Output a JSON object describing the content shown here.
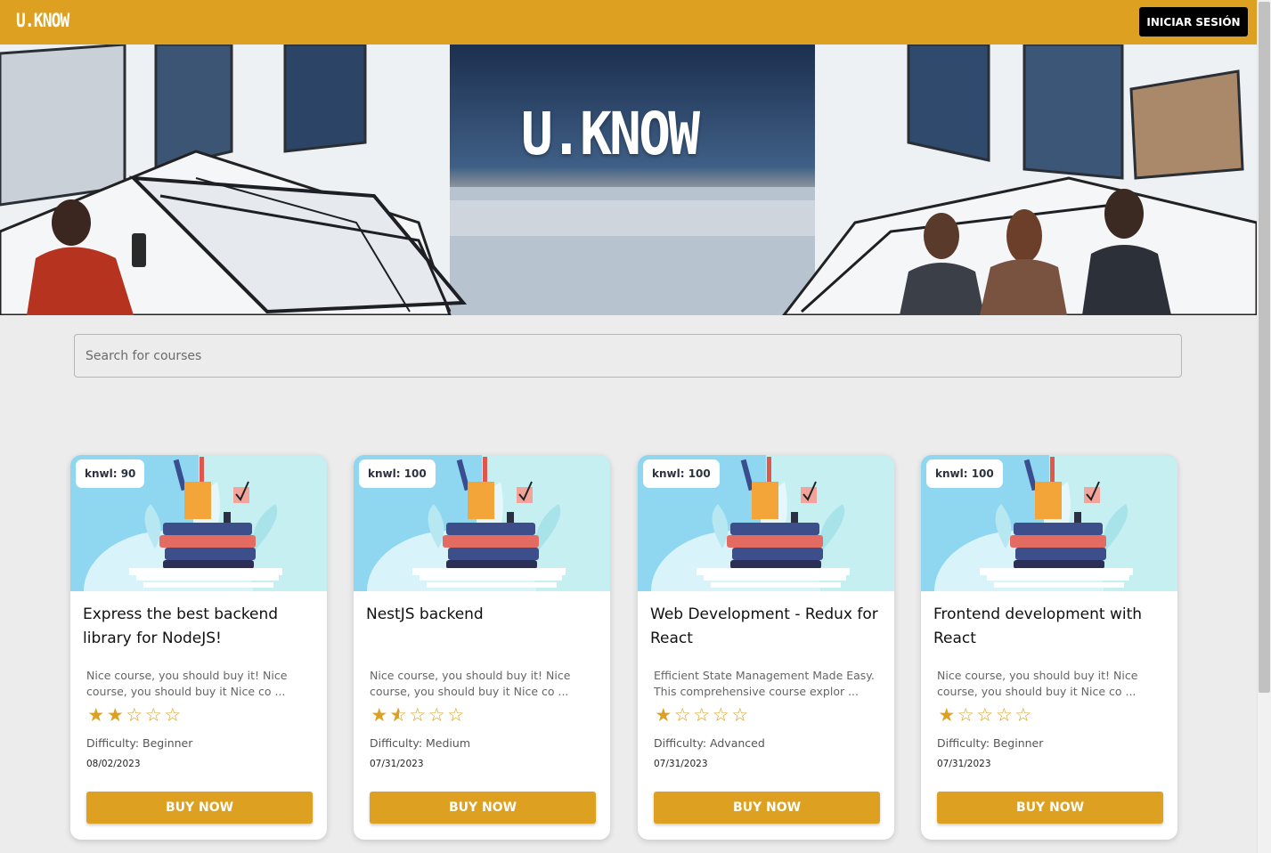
{
  "header": {
    "logo": "U.KNOW",
    "login_label": "INICIAR SESIÓN"
  },
  "hero": {
    "title": "U.KNOW"
  },
  "search": {
    "placeholder": "Search for courses"
  },
  "colors": {
    "accent": "#dda020",
    "background": "#ececec"
  },
  "courses": [
    {
      "badge": "knwl: 90",
      "title": "Express the best backend library for NodeJS!",
      "description": "Nice course, you should buy it! Nice course, you should buy it Nice co ...",
      "rating": 2,
      "rating_max": 5,
      "difficulty": "Difficulty: Beginner",
      "date": "08/02/2023",
      "button": "BUY NOW"
    },
    {
      "badge": "knwl: 100",
      "title": "NestJS backend",
      "description": "Nice course, you should buy it! Nice course, you should buy it Nice co ...",
      "rating": 1.5,
      "rating_max": 5,
      "difficulty": "Difficulty: Medium",
      "date": "07/31/2023",
      "button": "BUY NOW"
    },
    {
      "badge": "knwl: 100",
      "title": "Web Development - Redux for React",
      "description": "Efficient State Management Made Easy. This comprehensive course explor ...",
      "rating": 1,
      "rating_max": 5,
      "difficulty": "Difficulty: Advanced",
      "date": "07/31/2023",
      "button": "BUY NOW"
    },
    {
      "badge": "knwl: 100",
      "title": "Frontend development with React",
      "description": "Nice course, you should buy it! Nice course, you should buy it Nice co ...",
      "rating": 1,
      "rating_max": 5,
      "difficulty": "Difficulty: Beginner",
      "date": "07/31/2023",
      "button": "BUY NOW"
    }
  ]
}
